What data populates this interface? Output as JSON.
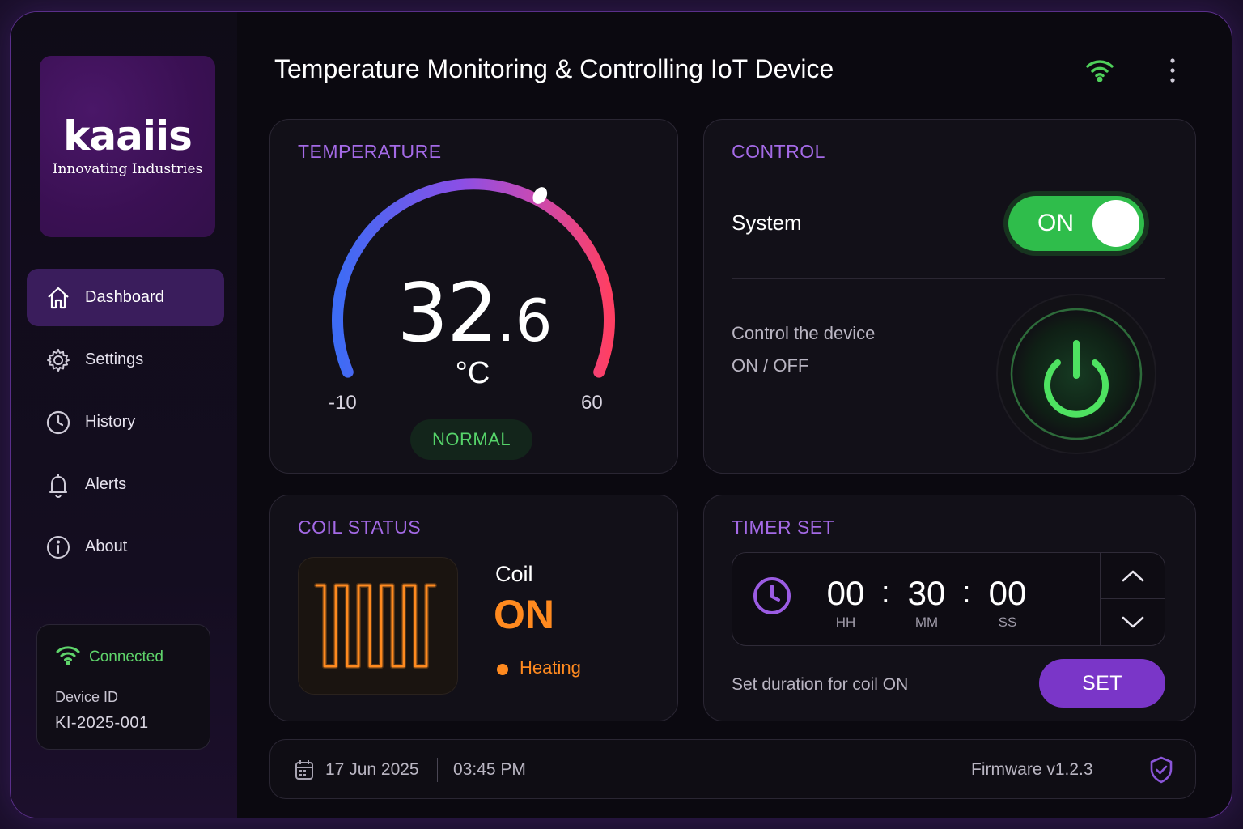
{
  "brand": {
    "name": "kaaiis",
    "tagline": "Innovating Industries"
  },
  "header": {
    "title": "Temperature Monitoring & Controlling IoT Device"
  },
  "sidebar": {
    "items": [
      {
        "label": "Dashboard",
        "icon": "home-icon",
        "active": true
      },
      {
        "label": "Settings",
        "icon": "gear-icon"
      },
      {
        "label": "History",
        "icon": "clock-icon"
      },
      {
        "label": "Alerts",
        "icon": "bell-icon"
      },
      {
        "label": "About",
        "icon": "info-icon"
      }
    ],
    "connection": {
      "status": "Connected",
      "device_id_label": "Device ID",
      "device_id": "KI-2025-001"
    }
  },
  "temperature": {
    "title": "TEMPERATURE",
    "value_int": "32",
    "value_dec": ".6",
    "value": 32.6,
    "unit": "°C",
    "min": "-10",
    "max": "60",
    "status": "NORMAL"
  },
  "control": {
    "title": "CONTROL",
    "system_label": "System",
    "toggle_state": "ON",
    "description_line1": "Control the device",
    "description_line2": "ON / OFF"
  },
  "coil": {
    "title": "COIL STATUS",
    "label": "Coil",
    "state": "ON",
    "substate": "Heating"
  },
  "timer": {
    "title": "TIMER SET",
    "hh": "00",
    "mm": "30",
    "ss": "00",
    "hh_label": "HH",
    "mm_label": "MM",
    "ss_label": "SS",
    "description": "Set duration for coil ON",
    "set_label": "SET"
  },
  "footer": {
    "date": "17 Jun 2025",
    "time": "03:45 PM",
    "firmware": "Firmware v1.2.3"
  },
  "colors": {
    "accent": "#a46ae6",
    "green": "#2fbd4b",
    "orange": "#ff8a1f",
    "button": "#7a36c8"
  }
}
